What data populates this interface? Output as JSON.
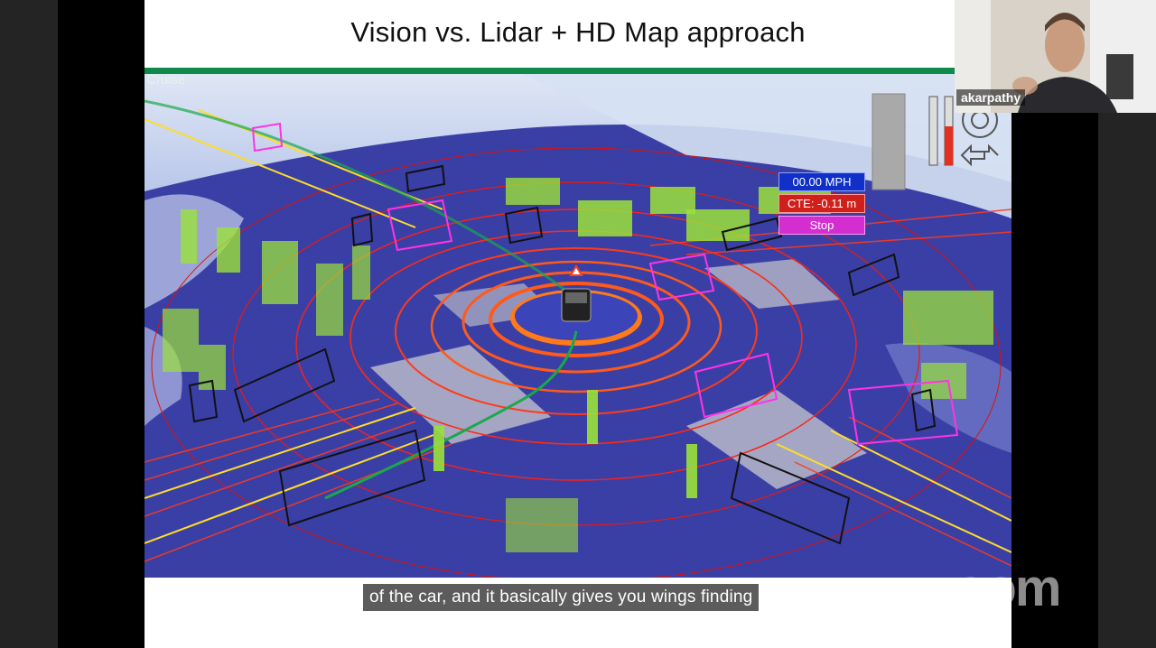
{
  "slide": {
    "title": "Vision vs. Lidar + HD Map approach"
  },
  "visualization": {
    "mode_label": "Cruise",
    "speed": "00.00 MPH",
    "cte": "CTE: -0.11 m",
    "stop": "Stop"
  },
  "caption": {
    "text": "of the car, and it basically gives you wings finding"
  },
  "participant": {
    "name": "akarpathy"
  },
  "app": {
    "logo": "zoom"
  },
  "colors": {
    "lidar_ring": "#ff5a1a",
    "vegetation": "#9be13a",
    "bounding_box_pedestrian": "#ff33e6",
    "ground": "#2f36a8",
    "accent_green": "#0f8a4a"
  }
}
